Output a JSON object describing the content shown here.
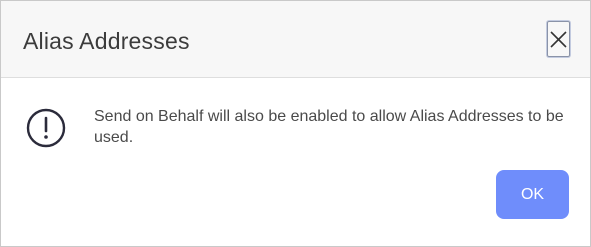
{
  "dialog": {
    "title": "Alias Addresses",
    "close_icon": "close-icon",
    "info_icon": "exclamation-circle-icon",
    "message": "Send on Behalf will also be enabled to allow Alias Addresses to be used.",
    "ok_label": "OK"
  },
  "colors": {
    "header_background": "#f7f7f7",
    "primary_button": "#6f8dfb",
    "icon_stroke": "#2b2b3b",
    "text": "#4a4a4a"
  }
}
